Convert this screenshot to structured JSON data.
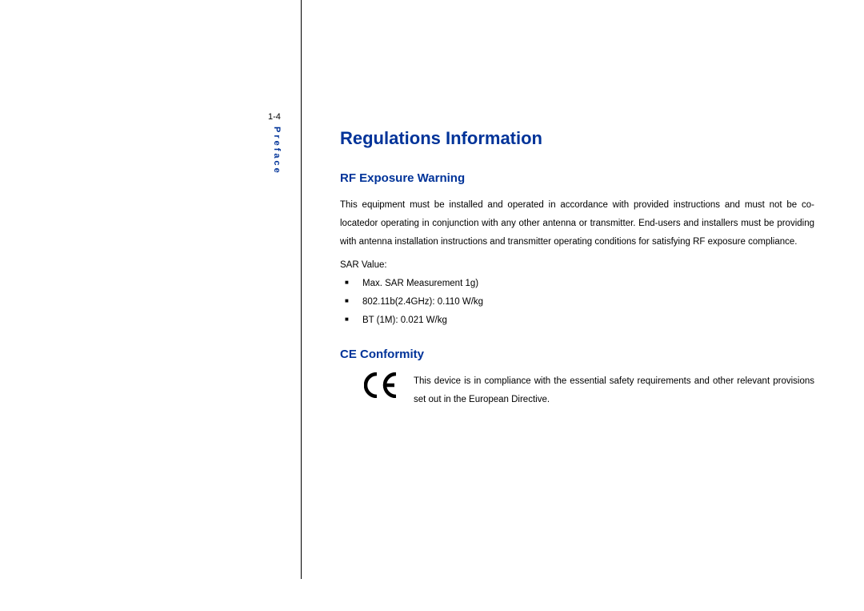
{
  "page_number": "1-4",
  "sidebar_label": "Preface",
  "heading_main": "Regulations Information",
  "rf_section": {
    "heading": "RF Exposure Warning",
    "paragraph": "This equipment must be installed and operated in accordance with provided instructions and must not be co-locatedor operating in conjunction with any other antenna or transmitter. End-users and installers must be providing with antenna installation instructions and transmitter operating conditions for satisfying RF exposure compliance.",
    "sar_label": "SAR Value:",
    "bullets": [
      "Max. SAR Measurement 1g)",
      "802.11b(2.4GHz): 0.110 W/kg",
      "BT (1M): 0.021 W/kg"
    ]
  },
  "ce_section": {
    "heading": "CE Conformity",
    "paragraph": "This device is in compliance with the essential safety requirements and other relevant provisions set out in the European Directive."
  }
}
